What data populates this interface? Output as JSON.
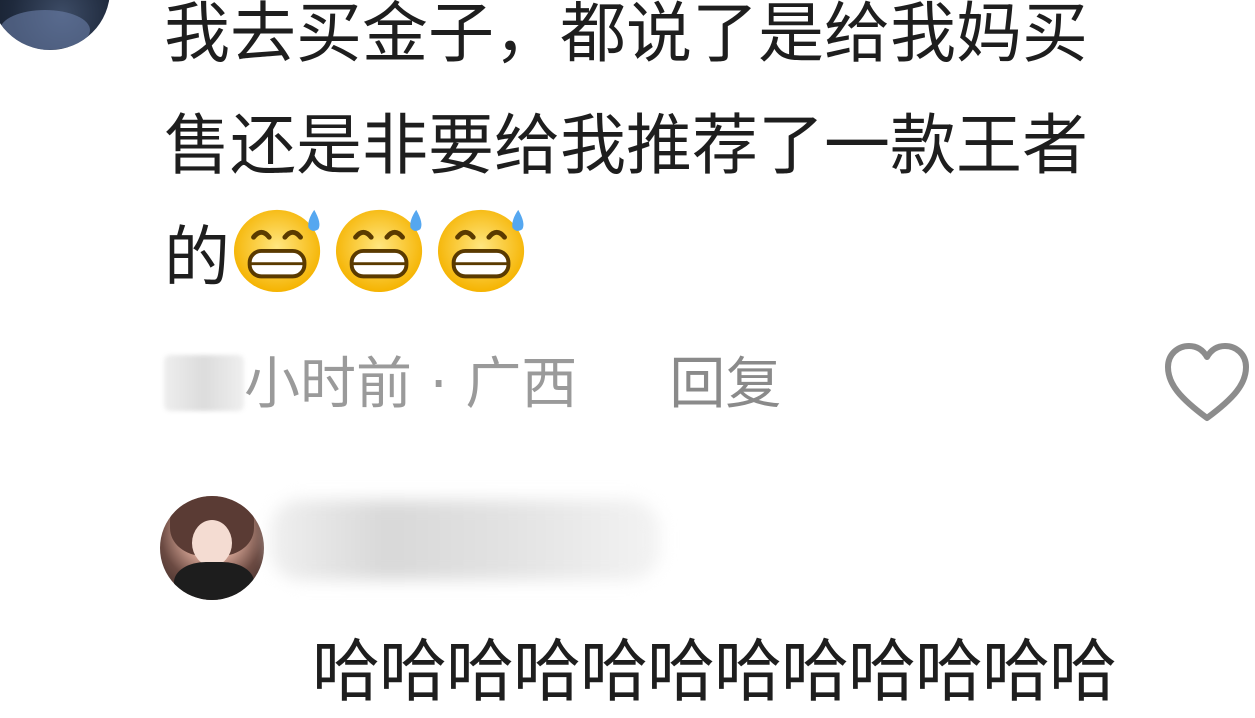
{
  "comment": {
    "line1": "我去买金子，都说了是给我妈买",
    "line2": "售还是非要给我推荐了一款王者",
    "line3": "的",
    "emoji": "sweat-grin-emoji"
  },
  "meta": {
    "time": "小时前",
    "separator": " · ",
    "location": "广西",
    "reply_label": "回复"
  },
  "icons": {
    "like": "heart-outline-icon"
  },
  "reply": {
    "text": "哈哈哈哈哈哈哈哈哈哈哈哈"
  }
}
